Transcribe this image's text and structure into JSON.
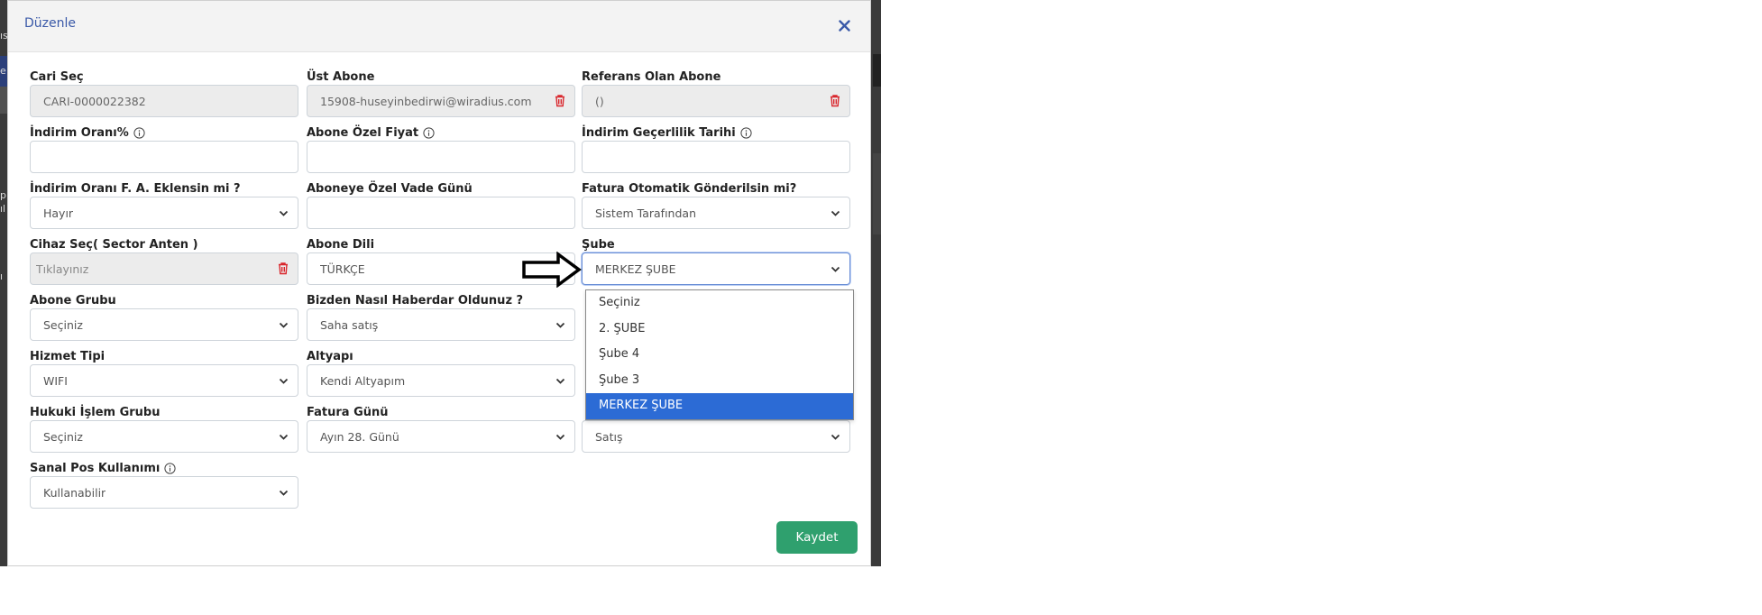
{
  "modal": {
    "title": "Düzenle",
    "save_label": "Kaydet"
  },
  "fields": {
    "cari_sec": {
      "label": "Cari Seç",
      "value": "CARI-0000022382"
    },
    "ust_abone": {
      "label": "Üst Abone",
      "value": "15908-huseyinbedirwi@wiradius.com"
    },
    "referans_abone": {
      "label": "Referans Olan Abone",
      "value": "()"
    },
    "indirim_orani": {
      "label": "İndirim Oranı%",
      "value": ""
    },
    "abone_ozel_fiyat": {
      "label": "Abone Özel Fiyat",
      "value": ""
    },
    "indirim_gecerlilik": {
      "label": "İndirim Geçerlilik Tarihi",
      "value": ""
    },
    "indirim_fa": {
      "label": "İndirim Oranı F. A. Eklensin mi ?",
      "value": "Hayır"
    },
    "ozel_vade": {
      "label": "Aboneye Özel Vade Günü",
      "value": ""
    },
    "fatura_otomatik": {
      "label": "Fatura Otomatik Gönderilsin mi?",
      "value": "Sistem Tarafından"
    },
    "cihaz_sec": {
      "label": "Cihaz Seç( Sector Anten )",
      "placeholder": "Tıklayınız"
    },
    "abone_dili": {
      "label": "Abone Dili",
      "value": "TÜRKÇE"
    },
    "sube": {
      "label": "Şube",
      "value": "MERKEZ ŞUBE"
    },
    "abone_grubu": {
      "label": "Abone Grubu",
      "value": "Seçiniz"
    },
    "bizden_nasil": {
      "label": "Bizden Nasıl Haberdar Oldunuz ?",
      "value": "Saha satış"
    },
    "hizmet_tipi": {
      "label": "Hizmet Tipi",
      "value": "WIFI"
    },
    "altyapi": {
      "label": "Altyapı",
      "value": "Kendi Altyapım"
    },
    "hukuki_islem": {
      "label": "Hukuki İşlem Grubu",
      "value": "Seçiniz"
    },
    "fatura_gunu": {
      "label": "Fatura Günü",
      "value": "Ayın 28. Günü"
    },
    "hidden_select": {
      "value": "Satış"
    },
    "sanal_pos": {
      "label": "Sanal Pos Kullanımı",
      "value": "Kullanabilir"
    }
  },
  "sube_options": [
    "Seçiniz",
    "2. ŞUBE",
    "Şube 4",
    "Şube 3",
    "MERKEZ ŞUBE"
  ],
  "background": {
    "fragments": [
      "ıs",
      "e",
      "p",
      "ıl",
      "ı"
    ]
  },
  "colors": {
    "accent": "#3a59a8",
    "save": "#2fa06e",
    "trash": "#d9262c",
    "selected_option": "#2c6bd5"
  }
}
